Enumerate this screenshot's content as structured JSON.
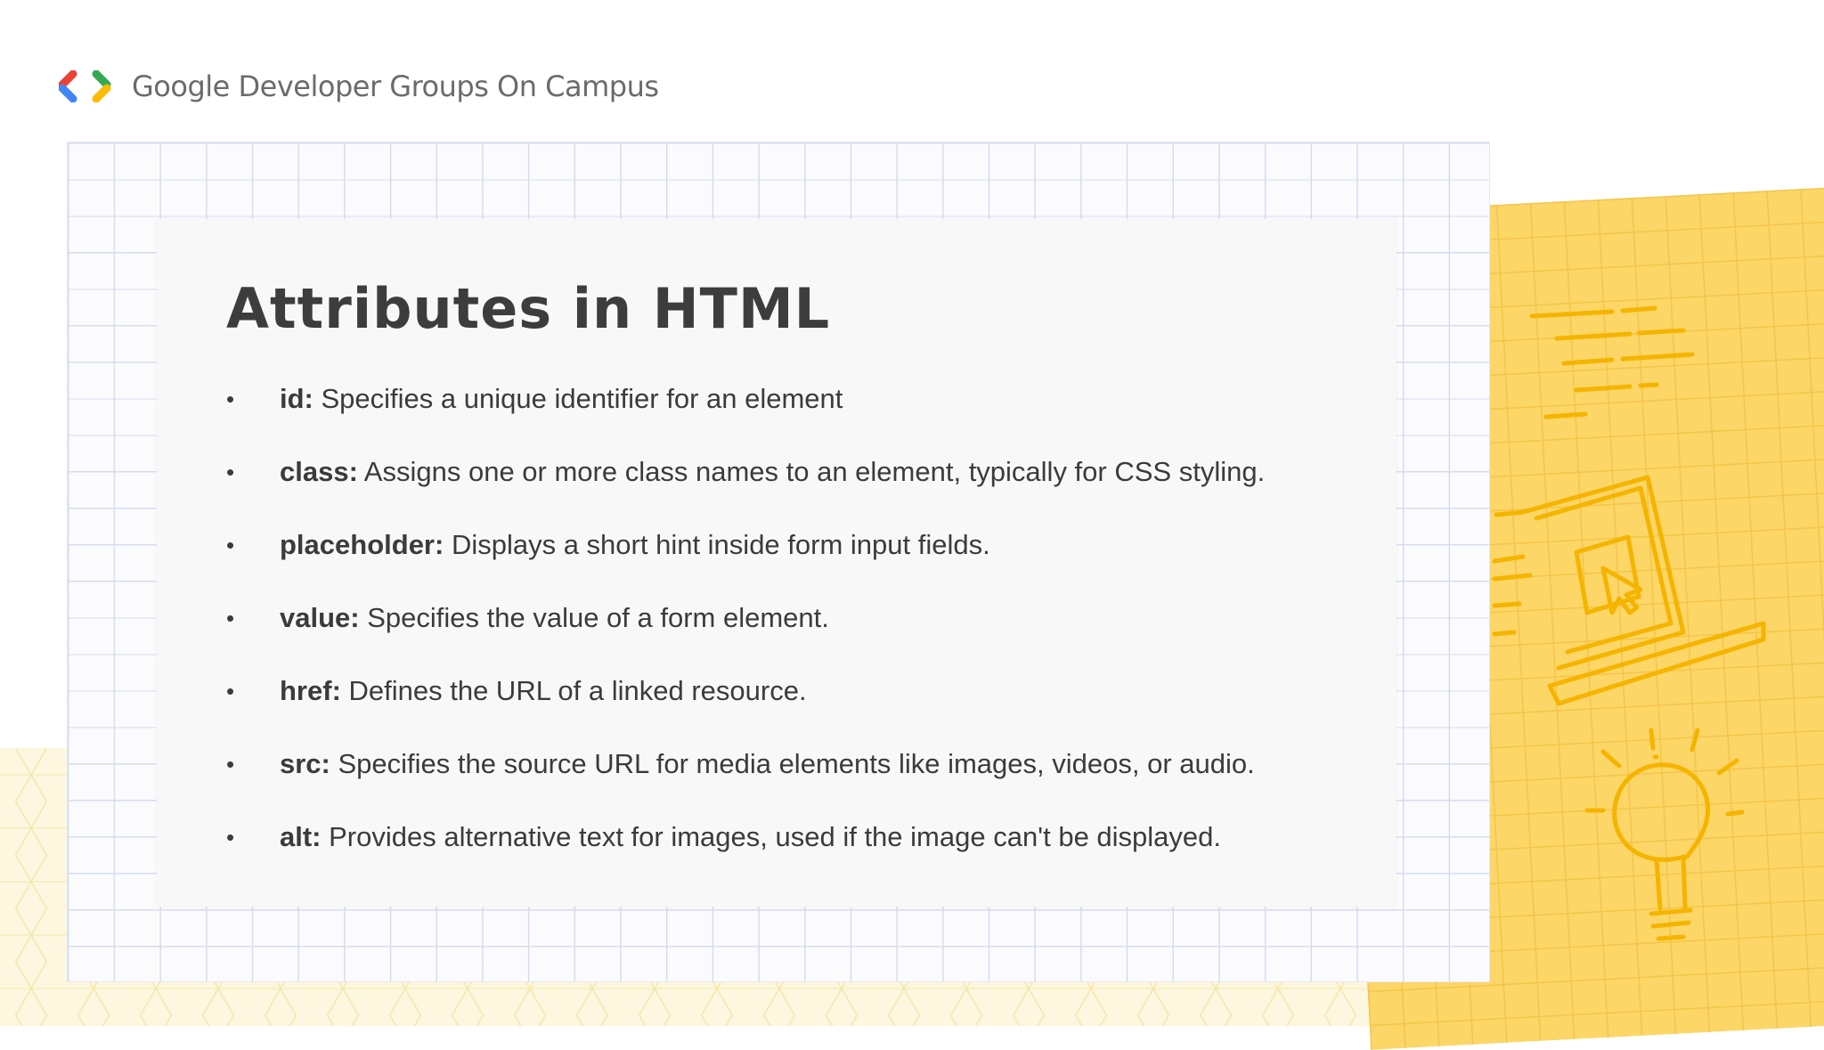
{
  "brand": {
    "name": "Google Developer Groups On Campus",
    "logo_icon": "gdg-chevrons-icon",
    "colors": {
      "red": "#ea4335",
      "blue": "#4285f4",
      "green": "#34a853",
      "yellow": "#fbbc04"
    }
  },
  "slide": {
    "title": "Attributes in HTML",
    "bullet_glyph": "•",
    "items": [
      {
        "term": "id:",
        "desc": " Specifies a unique identifier for an element"
      },
      {
        "term": "class:",
        "desc": " Assigns one or more class names to an element, typically for CSS styling."
      },
      {
        "term": "placeholder:",
        "desc": " Displays a short hint inside form input fields."
      },
      {
        "term": "value:",
        "desc": " Specifies the value of a form element."
      },
      {
        "term": "href:",
        "desc": " Defines the URL of a linked resource."
      },
      {
        "term": "src:",
        "desc": " Specifies the source URL for media elements like images, videos, or audio."
      },
      {
        "term": "alt:",
        "desc": " Provides alternative text for images, used if the image can't be displayed."
      }
    ]
  },
  "decorations": {
    "paper_color": "#fcd667",
    "doodle_color": "#f5b400",
    "icons": [
      "text-lines-doodle-icon",
      "laptop-cursor-doodle-icon",
      "lightbulb-doodle-icon"
    ]
  }
}
